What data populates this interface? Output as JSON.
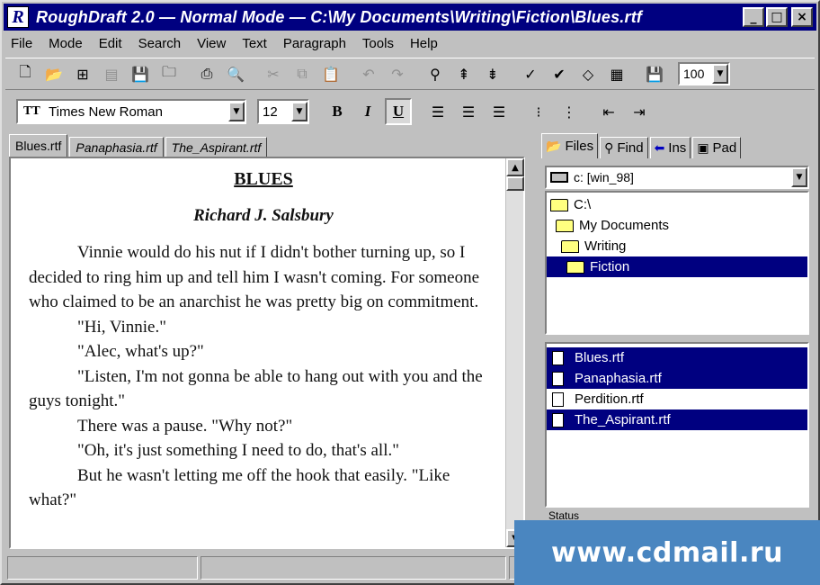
{
  "window": {
    "title": "RoughDraft 2.0  — Normal Mode  — C:\\My Documents\\Writing\\Fiction\\Blues.rtf",
    "logo_letter": "R",
    "controls": {
      "minimize": "_",
      "maximize": "□",
      "close": "×"
    }
  },
  "menu": [
    "File",
    "Mode",
    "Edit",
    "Search",
    "View",
    "Text",
    "Paragraph",
    "Tools",
    "Help"
  ],
  "toolbar": {
    "icons": [
      "new-document-icon",
      "open-folder-icon",
      "insert-icon",
      "print-preview-icon",
      "save-icon",
      "folder-icon",
      "printer-icon",
      "magnify-icon",
      "cut-icon",
      "copy-icon",
      "paste-icon",
      "undo-icon",
      "redo-icon",
      "find-icon",
      "find-previous-icon",
      "find-next-icon",
      "spellcheck-icon",
      "thesaurus-icon",
      "eraser-icon",
      "notes-icon",
      "save-all-icon"
    ],
    "zoom": "100"
  },
  "format": {
    "font_name": "Times New Roman",
    "font_icon": "TT",
    "font_size": "12",
    "bold": "B",
    "italic": "I",
    "underline": "U"
  },
  "doc_tabs": [
    "Blues.rtf",
    "Panaphasia.rtf",
    "The_Aspirant.rtf"
  ],
  "document": {
    "title": "BLUES",
    "author": "Richard J. Salsbury",
    "paragraphs": [
      "Vinnie would do his nut if I didn't bother turning up, so I decided to ring him up and tell him I wasn't coming. For someone who claimed to be an anarchist he was pretty big on commitment.",
      "\"Hi, Vinnie.\"",
      "\"Alec, what's up?\"",
      "\"Listen, I'm not gonna be able to hang out with you and the guys tonight.\"",
      "There was a pause. \"Why not?\"",
      "\"Oh, it's just something I need to do, that's all.\"",
      "But he wasn't letting me off the hook that easily. \"Like what?\""
    ]
  },
  "side_tabs": [
    "Files",
    "Find",
    "Ins",
    "Pad"
  ],
  "drive": "c: [win_98]",
  "folders": [
    {
      "name": "C:\\",
      "selected": false
    },
    {
      "name": "My Documents",
      "selected": false
    },
    {
      "name": "Writing",
      "selected": false
    },
    {
      "name": "Fiction",
      "selected": true
    }
  ],
  "files": [
    {
      "name": "Blues.rtf",
      "selected": true
    },
    {
      "name": "Panaphasia.rtf",
      "selected": true
    },
    {
      "name": "Perdition.rtf",
      "selected": false
    },
    {
      "name": "The_Aspirant.rtf",
      "selected": true
    }
  ],
  "side_status": "Status",
  "watermark": "www.cdmail.ru",
  "colors": {
    "titlebar": "#000080",
    "selection": "#000080",
    "face": "#c0c0c0",
    "watermark_bg": "#4a86c0"
  }
}
